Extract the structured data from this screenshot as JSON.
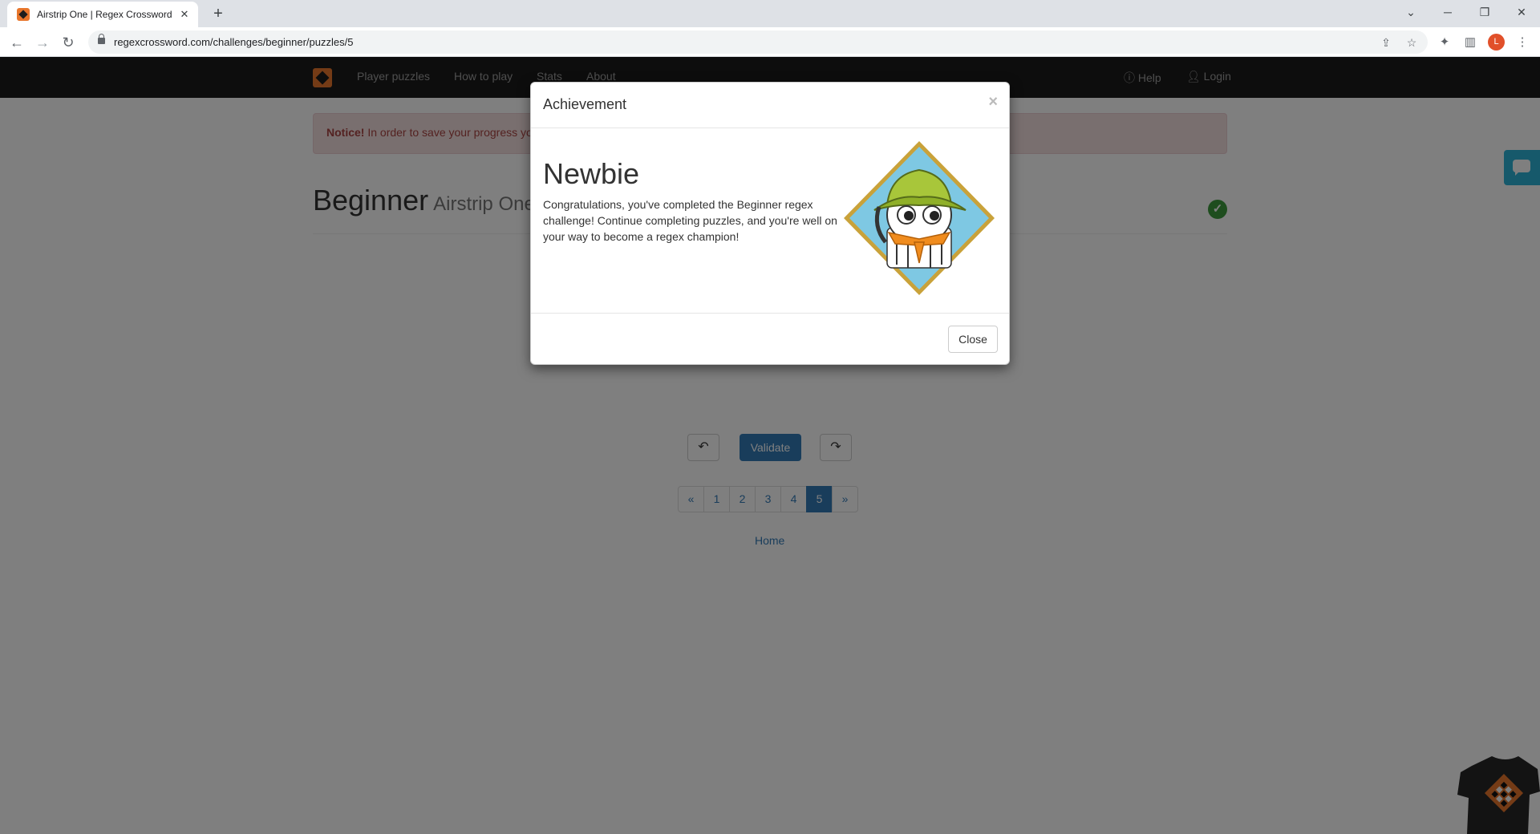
{
  "browser": {
    "tab_title": "Airstrip One | Regex Crossword",
    "tab_close": "✕",
    "new_tab": "+",
    "url": "regexcrossword.com/challenges/beginner/puzzles/5",
    "profile_initial": "L"
  },
  "navbar": {
    "items": [
      "Player puzzles",
      "How to play",
      "Stats",
      "About"
    ],
    "help": "Help",
    "login": "Login"
  },
  "notice": {
    "bold": "Notice!",
    "text": " In order to save your progress you"
  },
  "heading": {
    "title": "Beginner",
    "subtitle": "Airstrip One"
  },
  "controls": {
    "undo_icon": "↶",
    "validate": "Validate",
    "redo_icon": "↷"
  },
  "pagination": {
    "prev": "«",
    "pages": [
      "1",
      "2",
      "3",
      "4",
      "5"
    ],
    "active_page": "5",
    "next": "»"
  },
  "home_link": "Home",
  "modal": {
    "title": "Achievement",
    "close_x": "×",
    "achievement_name": "Newbie",
    "description": "Congratulations, you've completed the Beginner regex challenge! Continue completing puzzles, and you're well on your way to become a regex champion!",
    "close_button": "Close"
  },
  "colors": {
    "navbar": "#1b1b1b",
    "brand": "#e8762c",
    "primary": "#337ab7",
    "success": "#3c9a3c",
    "notice_bg": "#f2dede",
    "notice_text": "#a94442",
    "feedback": "#2db3d6"
  },
  "icons": [
    "back-arrow-icon",
    "forward-arrow-icon",
    "reload-icon",
    "lock-icon",
    "share-icon",
    "star-icon",
    "extensions-icon",
    "side-panel-icon",
    "kebab-menu-icon",
    "help-circle-icon",
    "user-icon",
    "check-circle-icon",
    "undo-icon",
    "redo-icon",
    "feedback-chat-icon"
  ]
}
